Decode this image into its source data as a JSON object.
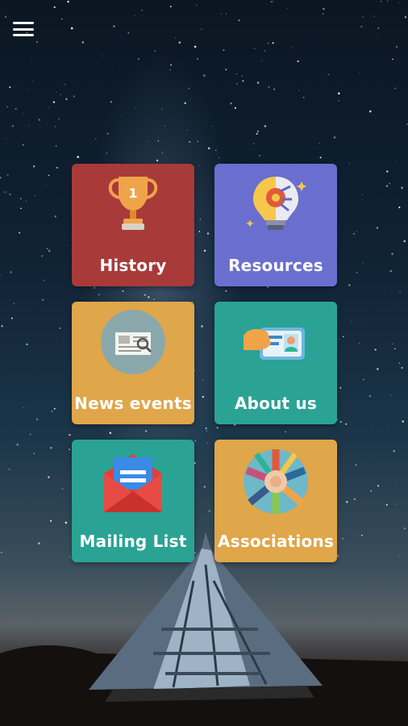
{
  "menu": {
    "icon": "hamburger-menu-icon"
  },
  "tiles": [
    {
      "label": "History",
      "icon": "trophy-icon",
      "color": "#a83a3a"
    },
    {
      "label": "Resources",
      "icon": "lightbulb-gear-icon",
      "color": "#6a6fcf"
    },
    {
      "label": "News events",
      "icon": "newspaper-icon",
      "color": "#e0a64a"
    },
    {
      "label": "About us",
      "icon": "id-card-icon",
      "color": "#2aa394"
    },
    {
      "label": "Mailing List",
      "icon": "mail-envelope-icon",
      "color": "#2aa394"
    },
    {
      "label": "Associations",
      "icon": "joined-hands-icon",
      "color": "#e0a64a"
    }
  ]
}
